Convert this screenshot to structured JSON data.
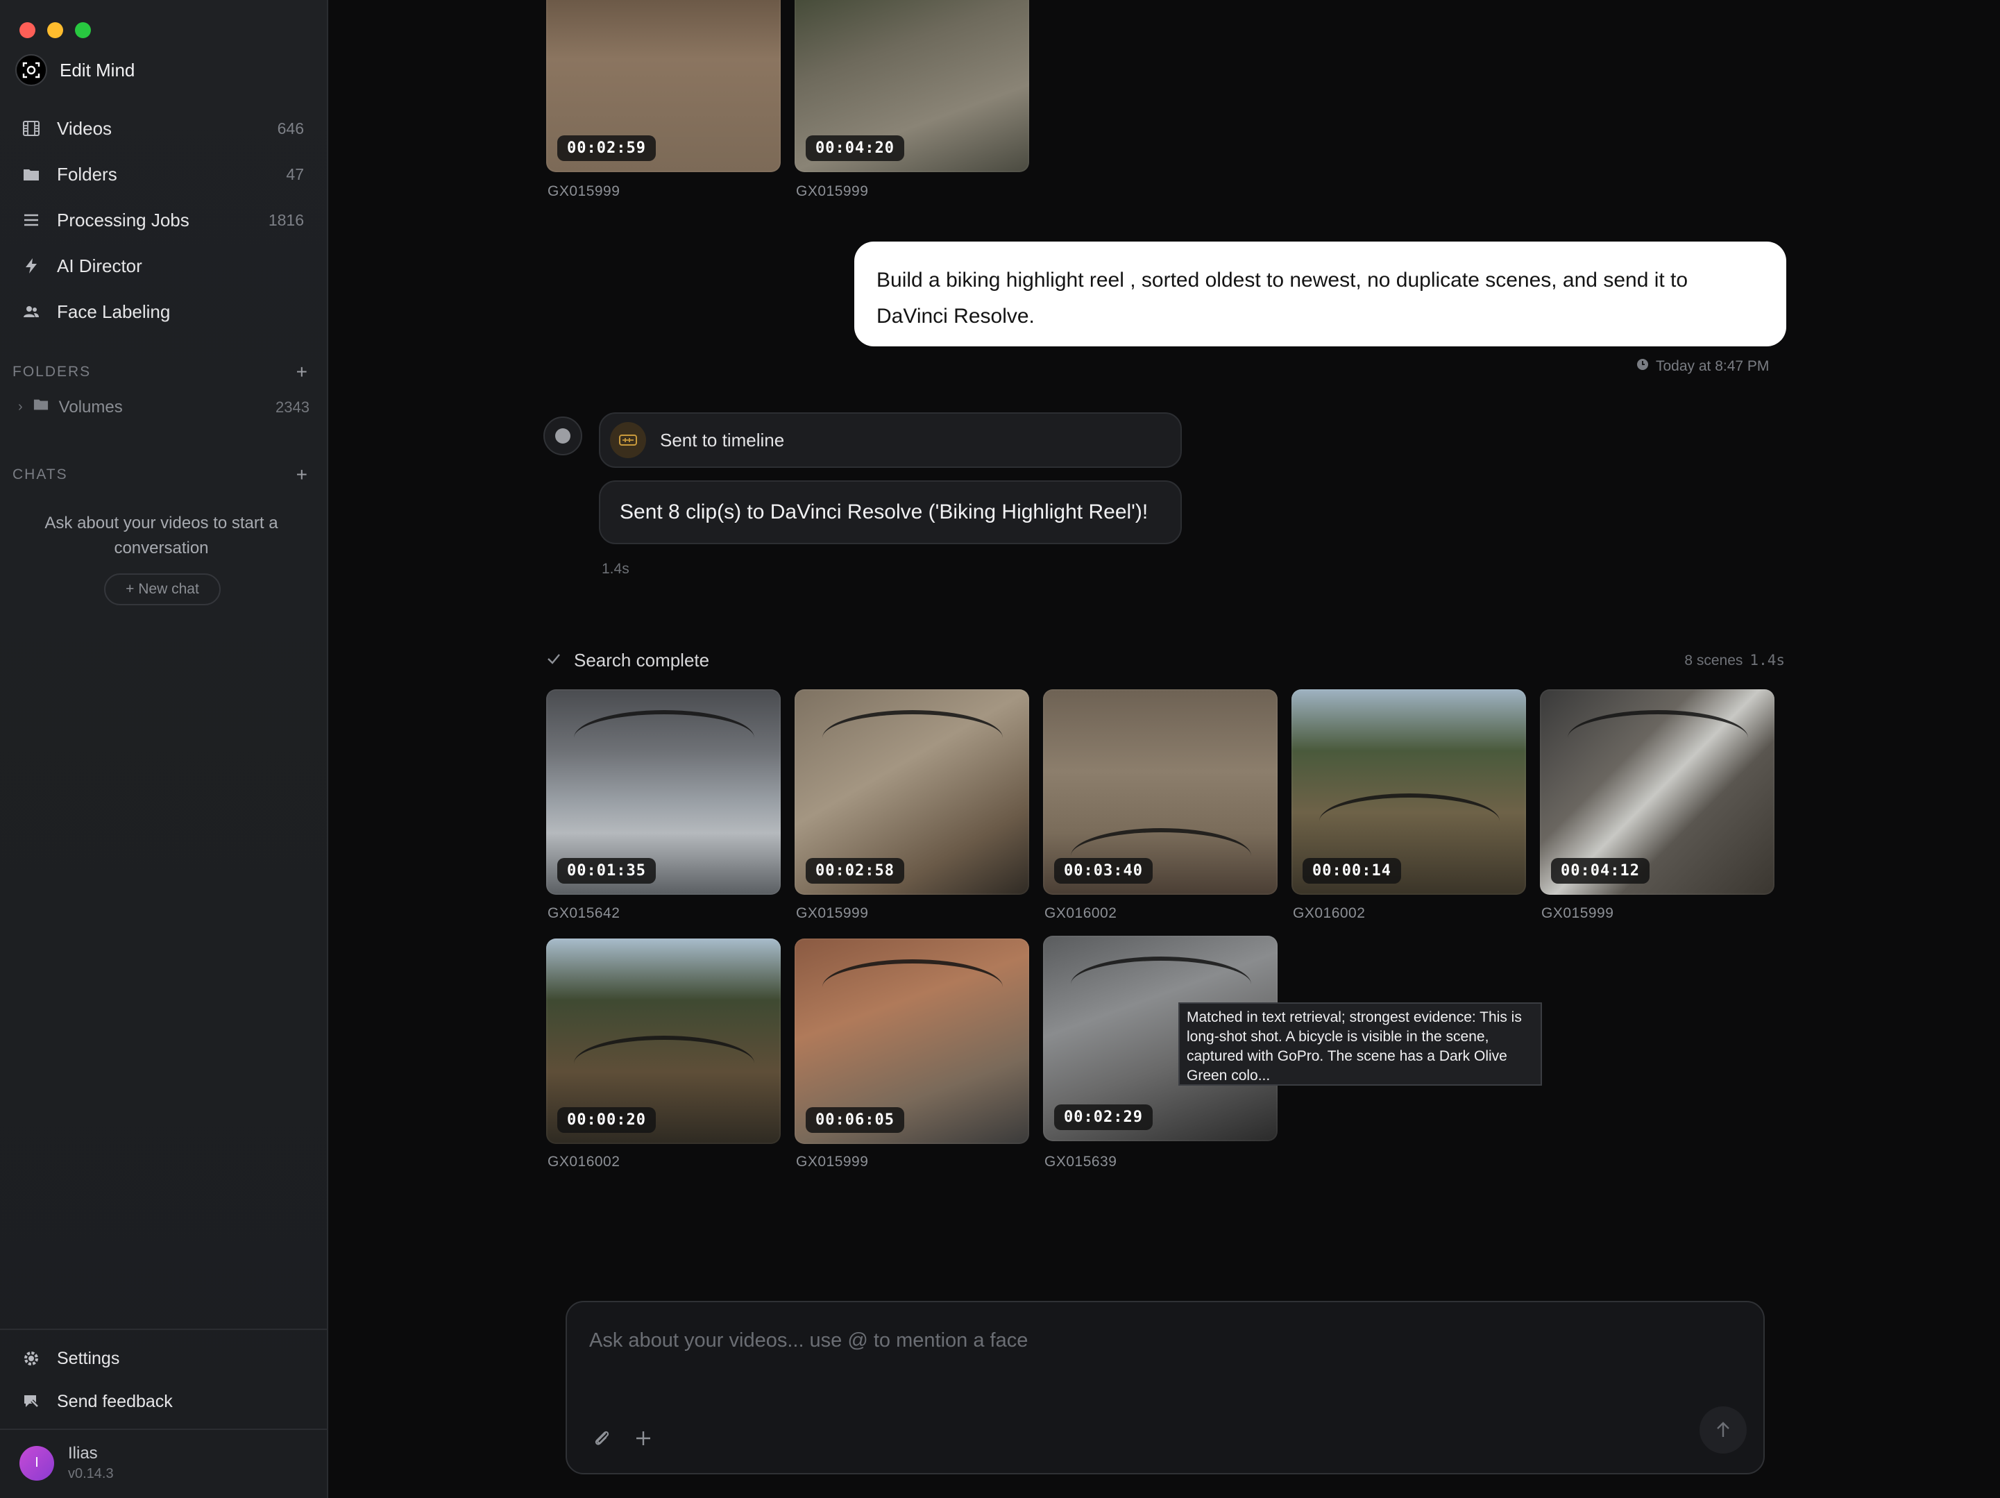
{
  "window": {
    "app_name": "Edit Mind"
  },
  "sidebar": {
    "nav": [
      {
        "label": "Videos",
        "count": "646",
        "icon": "film-grid-icon"
      },
      {
        "label": "Folders",
        "count": "47",
        "icon": "folder-icon"
      },
      {
        "label": "Processing Jobs",
        "count": "1816",
        "icon": "list-icon"
      },
      {
        "label": "AI Director",
        "count": "",
        "icon": "lightning-icon"
      },
      {
        "label": "Face Labeling",
        "count": "",
        "icon": "users-icon"
      }
    ],
    "folders_section": {
      "title": "FOLDERS",
      "add": "+"
    },
    "folder_items": [
      {
        "label": "Volumes",
        "count": "2343"
      }
    ],
    "chats_section": {
      "title": "CHATS",
      "add": "+"
    },
    "chats_empty": "Ask about your videos to start a conversation",
    "new_chat": "+ New chat",
    "bottom": [
      {
        "label": "Settings",
        "icon": "gear-icon"
      },
      {
        "label": "Send feedback",
        "icon": "feedback-icon"
      }
    ],
    "user": {
      "initial": "I",
      "name": "Ilias",
      "version": "v0.14.3"
    }
  },
  "chat": {
    "top_clips": [
      {
        "timecode": "00:02:59",
        "file": "GX015999"
      },
      {
        "timecode": "00:04:20",
        "file": "GX015999"
      }
    ],
    "user_message": "Build a biking highlight reel , sorted oldest to newest, no duplicate scenes, and send it to DaVinci Resolve.",
    "user_message_time": "Today at 8:47 PM",
    "tool_call": {
      "label": "Sent to timeline"
    },
    "tool_result": "Sent 8 clip(s) to DaVinci Resolve ('Biking Highlight Reel')!",
    "tool_duration": "1.4s",
    "search": {
      "status": "Search complete",
      "scenes_count": "8 scenes",
      "duration": "1.4s",
      "clips": [
        {
          "timecode": "00:01:35",
          "file": "GX015642"
        },
        {
          "timecode": "00:02:58",
          "file": "GX015999"
        },
        {
          "timecode": "00:03:40",
          "file": "GX016002"
        },
        {
          "timecode": "00:00:14",
          "file": "GX016002"
        },
        {
          "timecode": "00:04:12",
          "file": "GX015999"
        },
        {
          "timecode": "00:00:20",
          "file": "GX016002"
        },
        {
          "timecode": "00:06:05",
          "file": "GX015999"
        },
        {
          "timecode": "00:02:29",
          "file": "GX015639"
        }
      ],
      "tooltip": "Matched in text retrieval; strongest evidence: This is long-shot shot. A bicycle is visible in the scene, captured with GoPro. The scene has a Dark Olive Green colo..."
    }
  },
  "composer": {
    "placeholder": "Ask about your videos... use @ to mention a face"
  },
  "colors": {
    "accent_tool": "#c99a3c",
    "user_bubble": "#ffffff",
    "avatar": "#b845d4"
  }
}
